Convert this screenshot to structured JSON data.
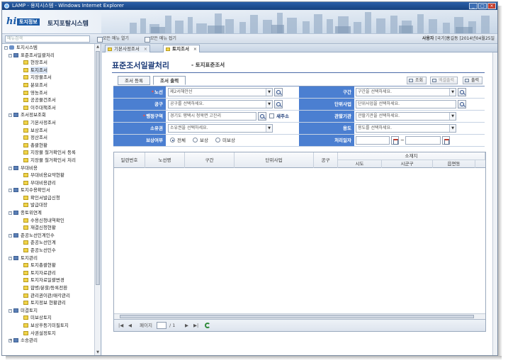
{
  "window": {
    "title": "LAMP - 용지시스템 - Windows Internet Explorer",
    "controls": [
      "_",
      "□",
      "×"
    ]
  },
  "header": {
    "logo_mark": "hi",
    "logo_text": "토지정보",
    "system_title": "토지포탈시스템"
  },
  "menubar": {
    "search_placeholder": "메뉴검색",
    "btn_open": "모든 메뉴 열기",
    "btn_close": "모든 메뉴 접기",
    "user_label": "사용자",
    "user_name": "[국가]홍길동",
    "login_info": "[2014년04월25일"
  },
  "sidebar": {
    "items": [
      {
        "level": "root",
        "toggle": "-",
        "label": "토지시스템"
      },
      {
        "level": "group",
        "toggle": "-",
        "label": "표준조서일괄처리"
      },
      {
        "level": "leaf",
        "label": "현장조서"
      },
      {
        "level": "leaf",
        "label": "토지조서",
        "selected": true
      },
      {
        "level": "leaf",
        "label": "지장물조서"
      },
      {
        "level": "leaf",
        "label": "분묘조서"
      },
      {
        "level": "leaf",
        "label": "영농조서"
      },
      {
        "level": "leaf",
        "label": "공공물건조서"
      },
      {
        "level": "leaf",
        "label": "이주대책조서"
      },
      {
        "level": "group",
        "toggle": "-",
        "label": "조서정보조회"
      },
      {
        "level": "leaf",
        "label": "기본사정조서"
      },
      {
        "level": "leaf",
        "label": "보상조서"
      },
      {
        "level": "leaf",
        "label": "정산조서"
      },
      {
        "level": "leaf",
        "label": "총괄현황"
      },
      {
        "level": "leaf",
        "label": "지장물 철거확인서 등록"
      },
      {
        "level": "leaf",
        "label": "지장물 철거확인서 처리"
      },
      {
        "level": "group",
        "toggle": "-",
        "label": "부대비용"
      },
      {
        "level": "leaf",
        "label": "부대비용요약현황"
      },
      {
        "level": "leaf",
        "label": "부대비용관리"
      },
      {
        "level": "group",
        "toggle": "-",
        "label": "토지수용확인서"
      },
      {
        "level": "leaf",
        "label": "확인서발급신청"
      },
      {
        "level": "leaf",
        "label": "발급대장"
      },
      {
        "level": "group",
        "toggle": "-",
        "label": "종토위연계"
      },
      {
        "level": "leaf",
        "label": "수용신청내역확인"
      },
      {
        "level": "leaf",
        "label": "재결신청현황"
      },
      {
        "level": "group",
        "toggle": "-",
        "label": "준공노선인계인수"
      },
      {
        "level": "leaf",
        "label": "준공노선인계"
      },
      {
        "level": "leaf",
        "label": "준공노선인수"
      },
      {
        "level": "group",
        "toggle": "-",
        "label": "토지관리"
      },
      {
        "level": "leaf",
        "label": "토지총괄현황"
      },
      {
        "level": "leaf",
        "label": "토지자료관리"
      },
      {
        "level": "leaf",
        "label": "토지자료일괄변경"
      },
      {
        "level": "leaf",
        "label": "합병/분할/등록전환"
      },
      {
        "level": "leaf",
        "label": "관리권이관/매각관리"
      },
      {
        "level": "leaf",
        "label": "토지정보 현황관리"
      },
      {
        "level": "group",
        "toggle": "-",
        "label": "미결토지"
      },
      {
        "level": "leaf",
        "label": "미보상토지"
      },
      {
        "level": "leaf",
        "label": "보상후등기미필토지"
      },
      {
        "level": "leaf",
        "label": "사권설정토지"
      },
      {
        "level": "group",
        "toggle": "+",
        "label": "소송관리"
      }
    ]
  },
  "tabs": [
    {
      "label": "기본사정조서",
      "close": "×",
      "active": false
    },
    {
      "label": "토지조서",
      "close": "×",
      "active": true
    }
  ],
  "page": {
    "title": "표준조서일괄처리",
    "dash": "-",
    "subtitle": "토지표준조서"
  },
  "subtabs": [
    "조서 등록",
    "조서 출력"
  ],
  "actions": {
    "query": "조회",
    "excel": "엑셀출력",
    "print": "출력"
  },
  "form": {
    "route_label": "노선",
    "route_value": "제2서해안선",
    "section_label": "구간",
    "section_placeholder": "구간을 선택하세요.",
    "work_label": "공구",
    "work_placeholder": "공구를 선택하세요.",
    "unit_label": "단위사업",
    "unit_placeholder": "단위사업을 선택하세요.",
    "admin_label": "행정구역",
    "admin_value": "경기도 평택시 청북면 고잔리",
    "new_addr_label": "새주소",
    "agency_label": "관할기관",
    "agency_placeholder": "관할기관을 선택하세요.",
    "owner_label": "소유권",
    "owner_placeholder": "소유권을 선택하세요.",
    "use_label": "용도",
    "use_placeholder": "용도를 선택하세요.",
    "comp_label": "보상여부",
    "comp_options": [
      "전체",
      "보상",
      "미보상"
    ],
    "date_label": "처리일자",
    "date_sep": "~",
    "dropdown_glyph": "▼"
  },
  "grid": {
    "headers": {
      "serial": "일련번호",
      "route": "노선명",
      "section": "구간",
      "unit": "단위사업",
      "work": "공구",
      "location": "소재지",
      "sido": "시도",
      "sigungu": "시군구",
      "eup": "읍면동"
    }
  },
  "pager": {
    "first": "|◀",
    "prev": "◀",
    "page_label": "페이지",
    "page_value": "",
    "total": "/ 1",
    "next": "▶",
    "last": "▶|"
  }
}
